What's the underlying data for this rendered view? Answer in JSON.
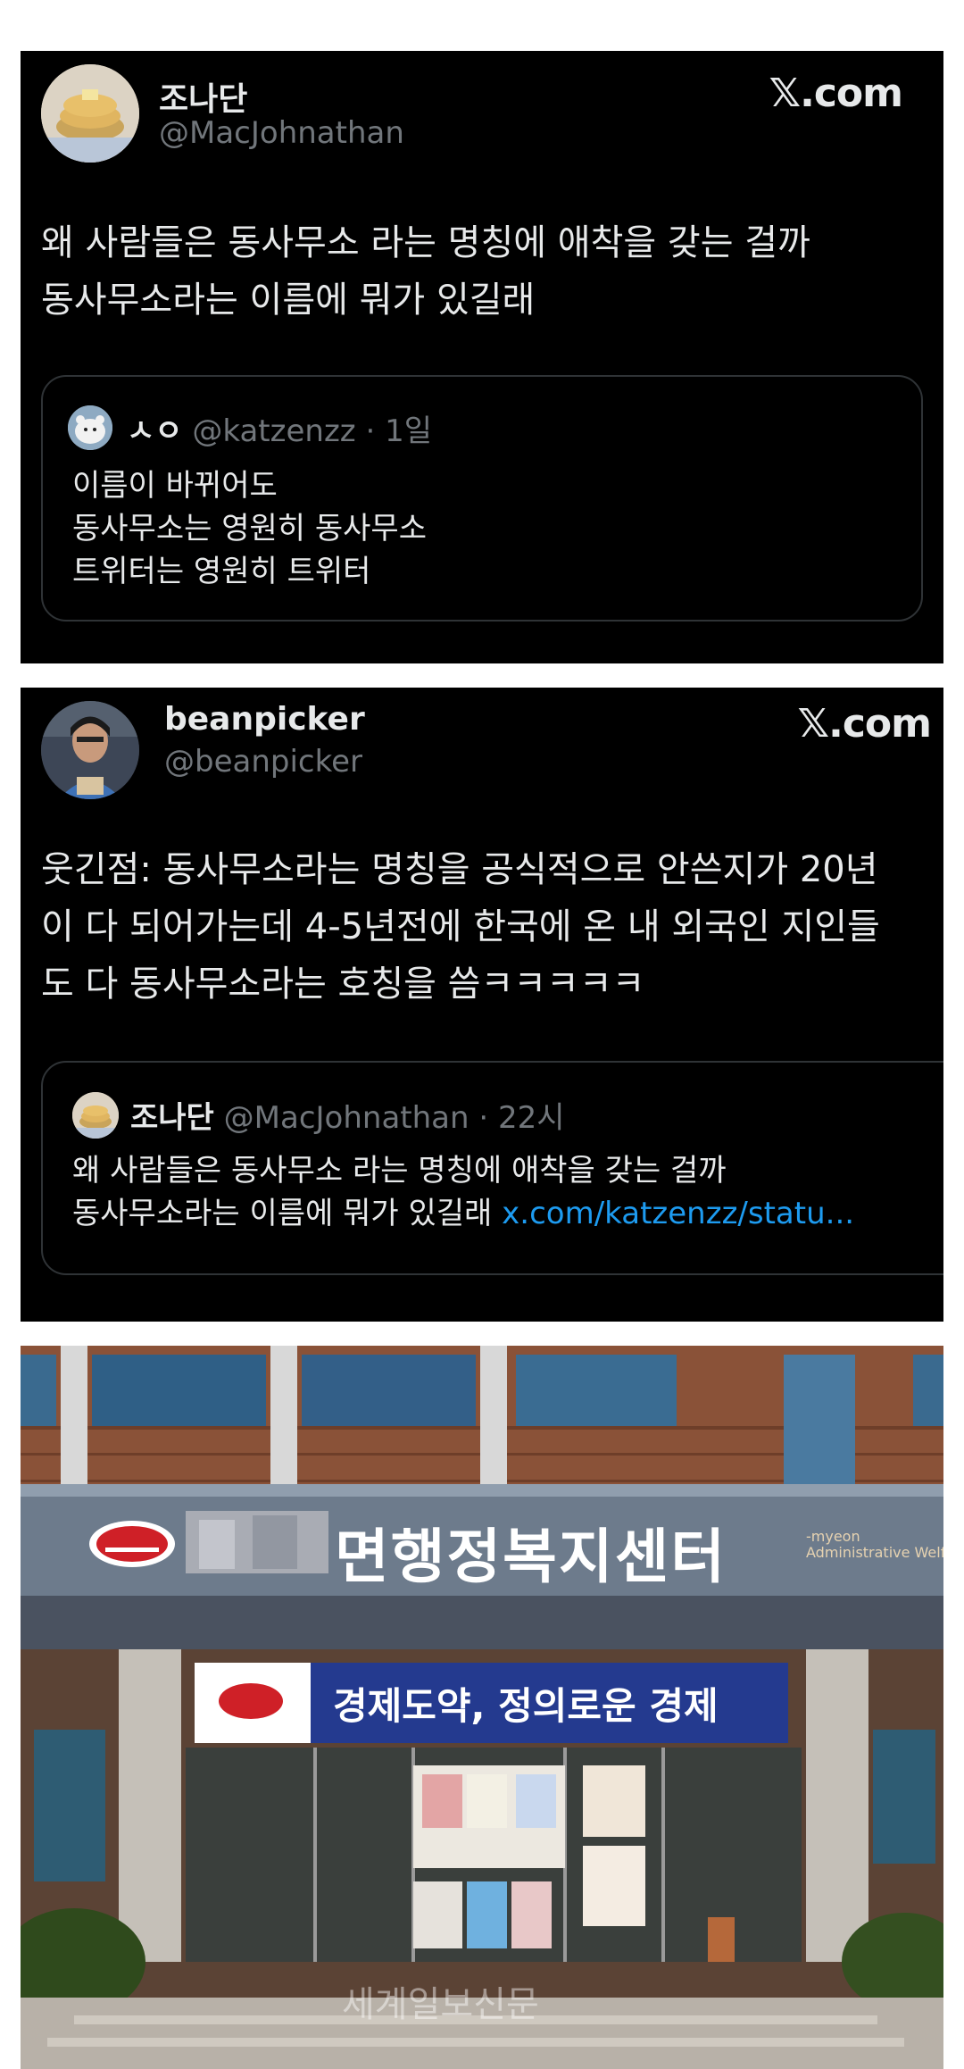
{
  "tweet1": {
    "name": "조나단",
    "handle": "@MacJohnathan",
    "site": "𝕏.com",
    "lines": [
      "왜 사람들은 동사무소 라는 명칭에 애착을 갖는 걸까",
      "동사무소라는 이름에 뭐가 있길래"
    ],
    "quote": {
      "name": "ㅅㅇ",
      "handle": "@katzenzz",
      "time": " · 1일",
      "lines": [
        "이름이 바뀌어도",
        "동사무소는 영원히 동사무소",
        "트위터는 영원히 트위터"
      ]
    }
  },
  "tweet2": {
    "name": "beanpicker",
    "handle": "@beanpicker",
    "site": "𝕏.com",
    "lines": [
      "웃긴점: 동사무소라는 명칭을 공식적으로 안쓴지가 20년",
      "이 다 되어가는데 4-5년전에 한국에 온 내 외국인 지인들",
      "도 다 동사무소라는 호칭을 씀ㅋㅋㅋㅋㅋ"
    ],
    "quote": {
      "name": "조나단",
      "handle": "@MacJohnathan",
      "time": " · 22시",
      "line1": "왜 사람들은 동사무소 라는 명칭에 애착을 갖는 걸까",
      "line2": "동사무소라는 이름에 뭐가 있길래 ",
      "link": "x.com/katzenzz/statu..."
    }
  },
  "photo": {
    "sign": "면행정복지센터",
    "sign_en_1": "-myeon",
    "sign_en_2": "Administrative Welfare",
    "banner": "경제도약, 정의로운 경제",
    "watermark": "세계일보신문"
  }
}
